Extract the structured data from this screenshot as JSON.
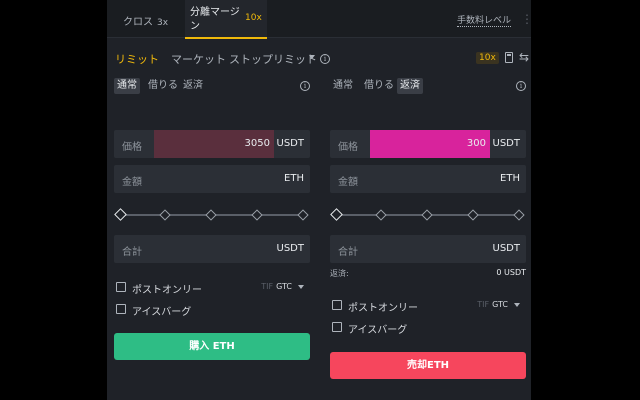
{
  "tabs": {
    "cross": {
      "label": "クロス",
      "leverage": "3x"
    },
    "isolated": {
      "label": "分離マージン",
      "leverage": "10x"
    },
    "fees_link": "手数料レベル",
    "accent": "#f0b90b"
  },
  "order_types": {
    "limit": "リミット",
    "market": "マーケット",
    "stop_limit": "ストップリミット",
    "leverage_badge": "10x"
  },
  "buy": {
    "modes": [
      "通常",
      "借りる",
      "返済"
    ],
    "active_mode": "通常",
    "price": {
      "label": "価格",
      "value": "3050",
      "unit": "USDT"
    },
    "amount": {
      "label": "金額",
      "value": "",
      "unit": "ETH"
    },
    "slider_percent": 0,
    "total": {
      "label": "合計",
      "value": "",
      "unit": "USDT"
    },
    "post_only": "ポストオンリー",
    "tif_label": "TIF",
    "tif_value": "GTC",
    "iceberg": "アイスバーグ",
    "button": "購入 ETH",
    "button_color": "#2ebd85"
  },
  "sell": {
    "modes": [
      "通常",
      "借りる",
      "返済"
    ],
    "active_mode": "返済",
    "price": {
      "label": "価格",
      "value": "300",
      "unit": "USDT"
    },
    "amount": {
      "label": "金額",
      "value": "",
      "unit": "ETH"
    },
    "slider_percent": 0,
    "total": {
      "label": "合計",
      "value": "",
      "unit": "USDT"
    },
    "repay_label": "返済:",
    "repay_value": "0 USDT",
    "post_only": "ポストオンリー",
    "tif_label": "TIF",
    "tif_value": "GTC",
    "iceberg": "アイスバーグ",
    "button": "売却ETH",
    "button_color": "#f6465d"
  },
  "icons": [
    "info-icon",
    "calculator-icon",
    "swap-icon",
    "kebab-menu-icon",
    "chevron-down-icon"
  ]
}
